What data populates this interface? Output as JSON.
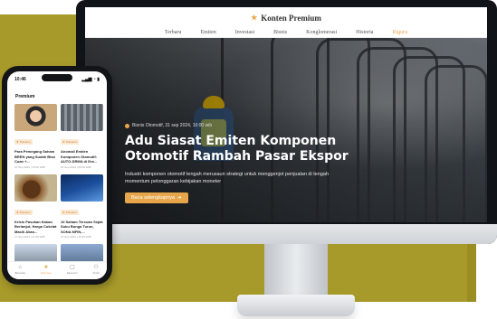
{
  "site": {
    "title": "Konten Premium",
    "nav": [
      "Terbaru",
      "Emiten",
      "Investasi",
      "Bisnis",
      "Konglomerasi",
      "Historia",
      "Riguru"
    ],
    "active_nav_index": 6
  },
  "hero": {
    "meta": "Bisnis Otomotif, 31 sep 2024, 10:00 wib",
    "title_line1": "Adu Siasat Emiten Komponen",
    "title_line2": "Otomotif Rambah Pasar Ekspor",
    "desc_line1": "Industri komponen otomotif tengah merusaun strategi untuk menggenjot penjualan di tengah",
    "desc_line2": "momentum pelonggaran kebijakan moneter",
    "button_label": "Baca selengkapnya",
    "button_arrow": "➔"
  },
  "phone": {
    "time": "10:46",
    "status_icons": "▂▄▆ ◔ ▮",
    "section_title": "Premium",
    "cards": [
      {
        "tag": "Premium",
        "title": "Para Pemegang Saham BREN yang Sudah Bisa Cuan +...",
        "date": "10 Sep 2024 | 15:50 WIB"
      },
      {
        "tag": "Premium",
        "title": "Anomali Emiten Komponen Otomotif: AUTO-DRMA di Era...",
        "date": "10 Sep 2024 | 09:00 WIB"
      },
      {
        "tag": "Premium",
        "title": "Krisis Pasokan Kakao Berlanjut, Harga Cokelat Masih Akan...",
        "date": "17 Sep 2024 | 17:00 WIB"
      },
      {
        "tag": "Premium",
        "title": "10 Saham Tercuan Sejak Suku Bunga Turun, SONA MFIN,...",
        "date": "27 Sep 2024 | 15:45 WIB"
      },
      {
        "tag": "",
        "title": "",
        "date": ""
      },
      {
        "tag": "",
        "title": "",
        "date": ""
      }
    ],
    "tabs": [
      {
        "icon": "⌂",
        "label": "Beranda"
      },
      {
        "icon": "★",
        "label": "Premium"
      },
      {
        "icon": "▢",
        "label": "Ekonomi"
      },
      {
        "icon": "⚇",
        "label": "Profil"
      }
    ],
    "active_tab_index": 1
  },
  "colors": {
    "accent": "#e8a64a",
    "backdrop": "#a79a2a"
  }
}
